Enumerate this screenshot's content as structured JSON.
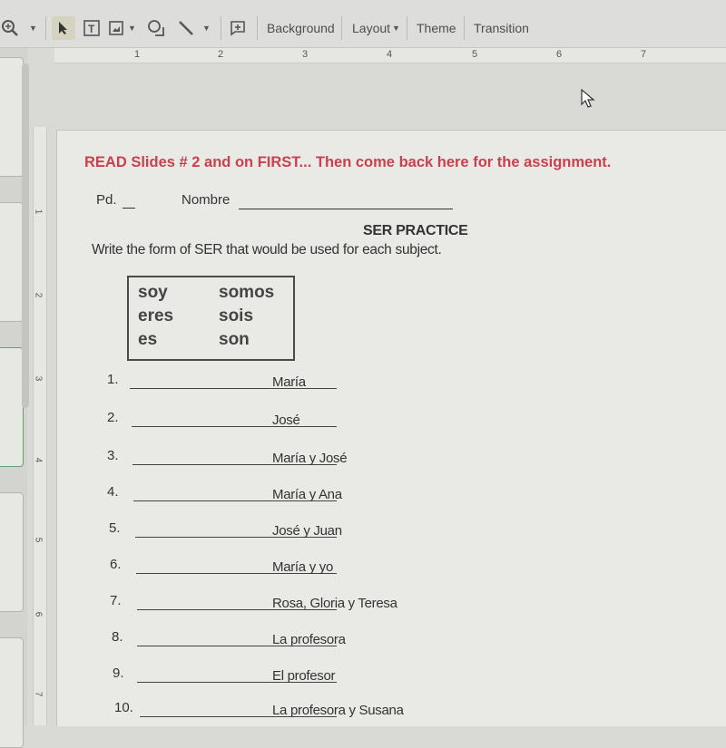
{
  "toolbar": {
    "zoom_icon": "zoom-in-icon",
    "select_icon": "cursor-arrow-icon",
    "textbox_icon": "text-box-icon",
    "image_icon": "image-icon",
    "shape_icon": "shape-icon",
    "line_icon": "line-icon",
    "comment_icon": "add-comment-icon",
    "background_label": "Background",
    "layout_label": "Layout",
    "theme_label": "Theme",
    "transition_label": "Transition"
  },
  "ruler": {
    "horizontal": [
      "1",
      "2",
      "3",
      "4",
      "5",
      "6",
      "7"
    ],
    "vertical": [
      "1",
      "2",
      "3",
      "4",
      "5",
      "6",
      "7"
    ]
  },
  "slide": {
    "instruction": "READ Slides # 2 and on FIRST... Then come back here for the assignment.",
    "pd_label": "Pd.",
    "nombre_label": "Nombre",
    "title": "SER PRACTICE",
    "directions": "Write the form of SER that would be used for each subject.",
    "conjugations": {
      "singular": [
        "soy",
        "eres",
        "es"
      ],
      "plural": [
        "somos",
        "sois",
        "son"
      ]
    },
    "questions": [
      {
        "num": "1.",
        "subject": "María"
      },
      {
        "num": "2.",
        "subject": "José"
      },
      {
        "num": "3.",
        "subject": "María y José"
      },
      {
        "num": "4.",
        "subject": "María y Ana"
      },
      {
        "num": "5.",
        "subject": "José y Juan"
      },
      {
        "num": "6.",
        "subject": "María y yo"
      },
      {
        "num": "7.",
        "subject": "Rosa, Gloria y Teresa"
      },
      {
        "num": "8.",
        "subject": "La profesora"
      },
      {
        "num": "9.",
        "subject": "El profesor"
      },
      {
        "num": "10.",
        "subject": "La profesora y Susana"
      }
    ]
  },
  "colors": {
    "instruction_red": "#c8414f",
    "text_dark": "#333333",
    "background": "#e9eae6"
  }
}
